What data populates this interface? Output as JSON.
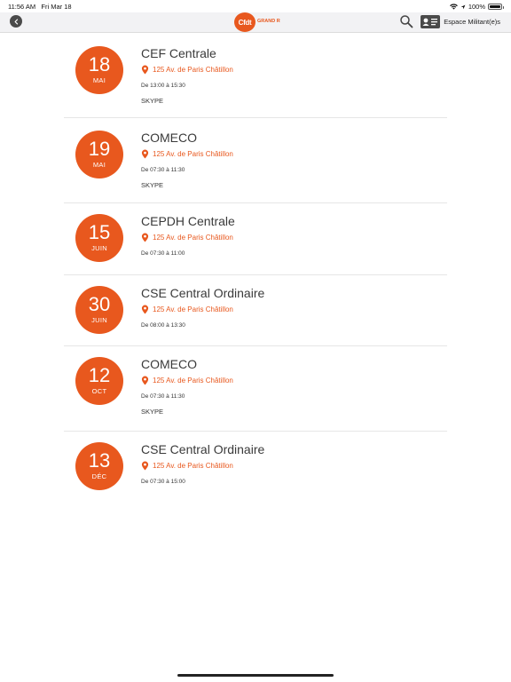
{
  "status": {
    "time": "11:56 AM",
    "date": "Fri Mar 18",
    "battery": "100%"
  },
  "nav": {
    "logo_text": "Cfdt",
    "logo_sub": "GRAND R",
    "espace_label": "Espace Militant(e)s"
  },
  "events": [
    {
      "day": "18",
      "month": "MAI",
      "title": "CEF Centrale",
      "address": "125 Av. de Paris Châtillon",
      "hours": "De 13:00 à 15:30",
      "note": "SKYPE"
    },
    {
      "day": "19",
      "month": "MAI",
      "title": "COMECO",
      "address": "125 Av. de Paris Châtillon",
      "hours": "De 07:30 à 11:30",
      "note": "SKYPE"
    },
    {
      "day": "15",
      "month": "JUIN",
      "title": "CEPDH Centrale",
      "address": "125 Av. de Paris Châtillon",
      "hours": "De 07:30 à 11:00",
      "note": ""
    },
    {
      "day": "30",
      "month": "JUIN",
      "title": "CSE Central Ordinaire",
      "address": "125 Av. de Paris Châtillon",
      "hours": "De 08:00 à 13:30",
      "note": ""
    },
    {
      "day": "12",
      "month": "OCT",
      "title": "COMECO",
      "address": "125 Av. de Paris Châtillon",
      "hours": "De 07:30 à 11:30",
      "note": "SKYPE"
    },
    {
      "day": "13",
      "month": "DÉC",
      "title": "CSE Central Ordinaire",
      "address": "125 Av. de Paris Châtillon",
      "hours": "De 07:30 à 15:00",
      "note": ""
    }
  ],
  "colors": {
    "accent": "#e8581e"
  }
}
